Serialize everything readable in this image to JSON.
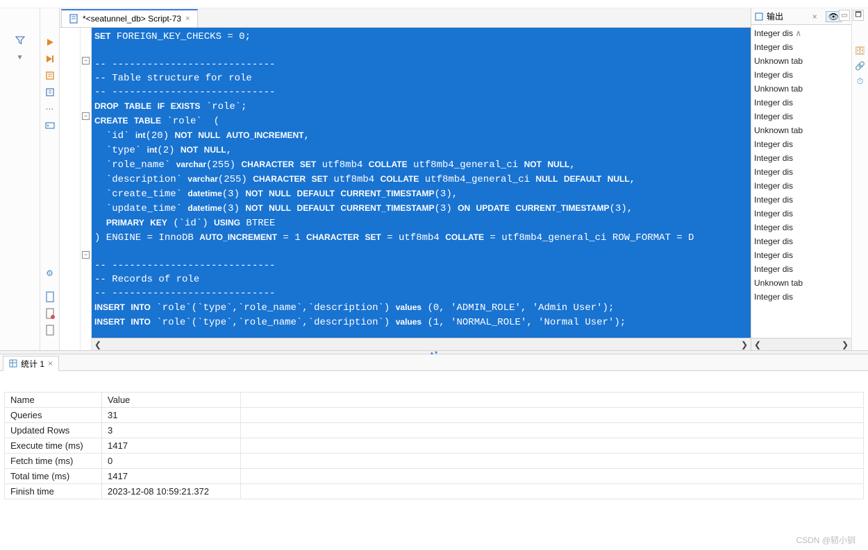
{
  "tab": {
    "label": "*<seatunnel_db> Script-73",
    "close": "×"
  },
  "code_lines": [
    {
      "t": "SET FOREIGN_KEY_CHECKS = 0;",
      "b": [
        "SET"
      ]
    },
    {
      "t": ""
    },
    {
      "t": "-- ----------------------------"
    },
    {
      "t": "-- Table structure for role"
    },
    {
      "t": "-- ----------------------------"
    },
    {
      "t": "DROP TABLE IF EXISTS `role`;",
      "b": [
        "DROP",
        "TABLE",
        "IF",
        "EXISTS"
      ]
    },
    {
      "t": "CREATE TABLE `role`  (",
      "b": [
        "CREATE",
        "TABLE"
      ]
    },
    {
      "t": "  `id` int(20) NOT NULL AUTO_INCREMENT,",
      "b": [
        "int",
        "NOT",
        "NULL",
        "AUTO_INCREMENT"
      ]
    },
    {
      "t": "  `type` int(2) NOT NULL,",
      "b": [
        "int",
        "NOT",
        "NULL"
      ]
    },
    {
      "t": "  `role_name` varchar(255) CHARACTER SET utf8mb4 COLLATE utf8mb4_general_ci NOT NULL,",
      "b": [
        "varchar",
        "CHARACTER",
        "SET",
        "COLLATE",
        "NOT",
        "NULL"
      ]
    },
    {
      "t": "  `description` varchar(255) CHARACTER SET utf8mb4 COLLATE utf8mb4_general_ci NULL DEFAULT NULL,",
      "b": [
        "varchar",
        "CHARACTER",
        "SET",
        "COLLATE",
        "NULL",
        "DEFAULT"
      ]
    },
    {
      "t": "  `create_time` datetime(3) NOT NULL DEFAULT CURRENT_TIMESTAMP(3),",
      "b": [
        "datetime",
        "NOT",
        "NULL",
        "DEFAULT",
        "CURRENT_TIMESTAMP"
      ]
    },
    {
      "t": "  `update_time` datetime(3) NOT NULL DEFAULT CURRENT_TIMESTAMP(3) ON UPDATE CURRENT_TIMESTAMP(3),",
      "b": [
        "datetime",
        "NOT",
        "NULL",
        "DEFAULT",
        "CURRENT_TIMESTAMP",
        "ON",
        "UPDATE"
      ]
    },
    {
      "t": "  PRIMARY KEY (`id`) USING BTREE",
      "b": [
        "PRIMARY",
        "KEY",
        "USING"
      ]
    },
    {
      "t": ") ENGINE = InnoDB AUTO_INCREMENT = 1 CHARACTER SET = utf8mb4 COLLATE = utf8mb4_general_ci ROW_FORMAT = D",
      "b": [
        "AUTO_INCREMENT",
        "CHARACTER",
        "SET",
        "COLLATE"
      ]
    },
    {
      "t": ""
    },
    {
      "t": "-- ----------------------------"
    },
    {
      "t": "-- Records of role"
    },
    {
      "t": "-- ----------------------------"
    },
    {
      "t": "INSERT INTO `role`(`type`,`role_name`,`description`) values (0, 'ADMIN_ROLE', 'Admin User');",
      "b": [
        "INSERT",
        "INTO",
        "values"
      ]
    },
    {
      "t": "INSERT INTO `role`(`type`,`role_name`,`description`) values (1, 'NORMAL_ROLE', 'Normal User');",
      "b": [
        "INSERT",
        "INTO",
        "values"
      ]
    }
  ],
  "output": {
    "title": "输出",
    "close": "×",
    "lines": [
      "Integer dis",
      "Integer dis",
      "Unknown tab",
      "Integer dis",
      "Unknown tab",
      "Integer dis",
      "Integer dis",
      "Unknown tab",
      "Integer dis",
      "Integer dis",
      "Integer dis",
      "Integer dis",
      "Integer dis",
      "Integer dis",
      "Integer dis",
      "Integer dis",
      "Integer dis",
      "Integer dis",
      "Unknown tab",
      "Integer dis"
    ]
  },
  "stats_tab": {
    "label": "统计 1",
    "close": "×"
  },
  "stats": {
    "headers": [
      "Name",
      "Value"
    ],
    "rows": [
      {
        "name": "Queries",
        "value": "31"
      },
      {
        "name": "Updated Rows",
        "value": "3"
      },
      {
        "name": "Execute time (ms)",
        "value": "1417"
      },
      {
        "name": "Fetch time (ms)",
        "value": "0"
      },
      {
        "name": "Total time (ms)",
        "value": "1417"
      },
      {
        "name": "Finish time",
        "value": "2023-12-08 10:59:21.372"
      }
    ]
  },
  "watermark": "CSDN @轫小钏",
  "scroll": {
    "up": "∧",
    "down": "∨",
    "left": "❮",
    "right": "❯"
  }
}
